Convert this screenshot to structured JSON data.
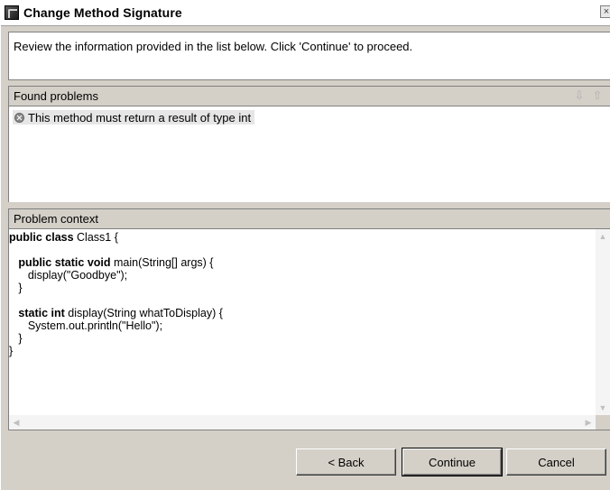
{
  "window": {
    "title": "Change Method Signature",
    "close_glyph": "×"
  },
  "description": "Review the information provided in the list below. Click 'Continue' to proceed.",
  "found_problems": {
    "label": "Found problems",
    "items": [
      {
        "icon": "error-icon",
        "text": "This method must return a result of type int"
      }
    ]
  },
  "problem_context": {
    "label": "Problem context",
    "code": [
      [
        {
          "t": "public class ",
          "b": true
        },
        {
          "t": "Class1 {",
          "b": false
        }
      ],
      [],
      [
        {
          "t": "   public static void ",
          "b": true
        },
        {
          "t": "main(String[] args) {",
          "b": false
        }
      ],
      [
        {
          "t": "      display(\"Goodbye\");",
          "b": false
        }
      ],
      [
        {
          "t": "   }",
          "b": false
        }
      ],
      [],
      [
        {
          "t": "   static int ",
          "b": true
        },
        {
          "t": "display(String whatToDisplay) {",
          "b": false
        }
      ],
      [
        {
          "t": "      System.out.println(\"Hello\");",
          "b": false
        }
      ],
      [
        {
          "t": "   }",
          "b": false
        }
      ],
      [
        {
          "t": "}",
          "b": false
        }
      ]
    ]
  },
  "buttons": {
    "back": "< Back",
    "continue": "Continue",
    "cancel": "Cancel"
  },
  "icons": {
    "next": "⇩",
    "previous": "⇧",
    "scroll_up": "▲",
    "scroll_down": "▼",
    "scroll_left": "◀",
    "scroll_right": "▶"
  }
}
